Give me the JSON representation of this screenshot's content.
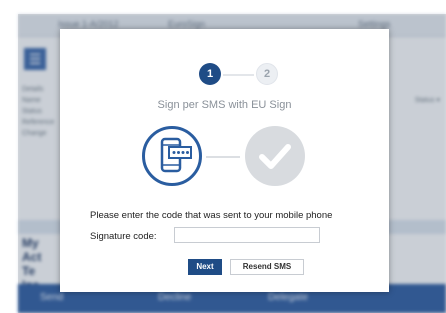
{
  "background": {
    "topbar_items": [
      "Issue 1-A/2012",
      "EuroSign",
      "Settings"
    ],
    "left_lines": [
      "Details",
      "Name",
      "Status",
      "Reference",
      "Change"
    ],
    "right_text": "Status ▾",
    "big_lines": [
      "My",
      "Act",
      "Te",
      "Ins"
    ],
    "bottom_buttons": [
      "Send",
      "Decline",
      "Delegate"
    ]
  },
  "dialog": {
    "steps": [
      "1",
      "2"
    ],
    "title": "Sign per SMS with EU Sign",
    "instructions": "Please enter the code that was sent to your mobile phone",
    "signature_label": "Signature code:",
    "signature_value": "",
    "signature_placeholder": "",
    "next_label": "Next",
    "resend_label": "Resend SMS"
  },
  "icons": {
    "phone": "phone-sms-icon",
    "check": "check-icon"
  },
  "colors": {
    "primary": "#1f4c86",
    "icon_blue": "#2a5da0",
    "inactive_grey": "#d8dbdf"
  }
}
